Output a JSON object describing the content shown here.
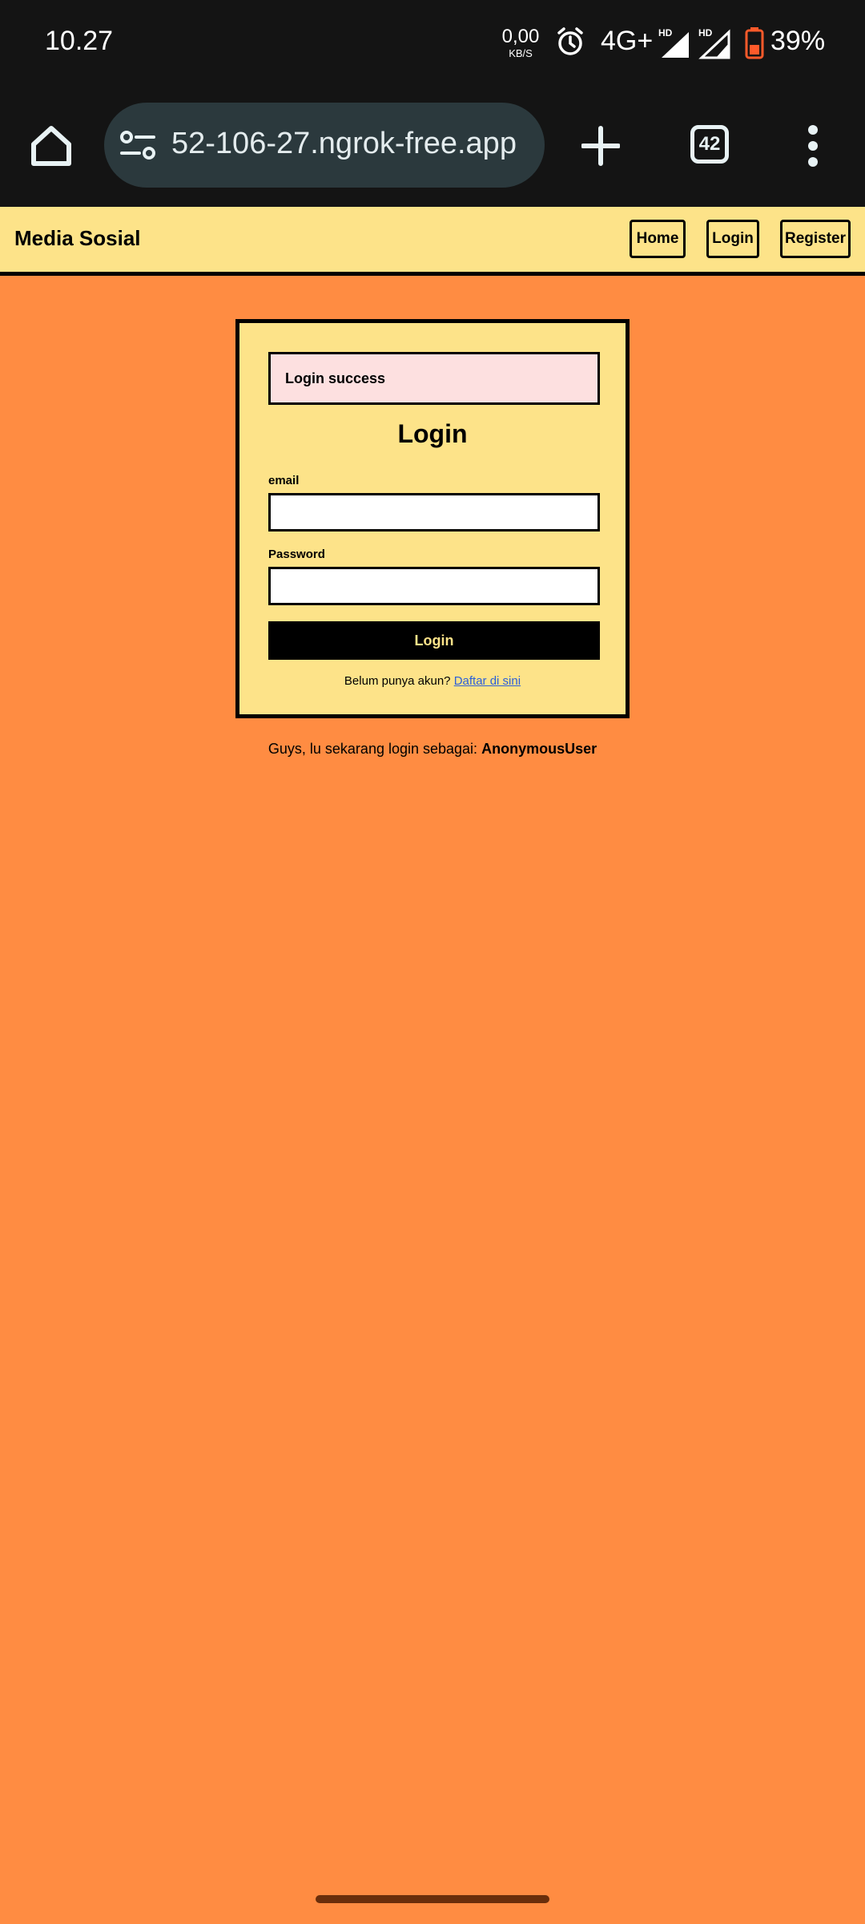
{
  "status_bar": {
    "time": "10.27",
    "net_speed_value": "0,00",
    "net_speed_unit": "KB/S",
    "network_type": "4G+",
    "battery_percent": "39%",
    "battery_color": "#ff5a2a"
  },
  "browser": {
    "url": "52-106-27.ngrok-free.app",
    "tab_count": "42",
    "icons": [
      "home-icon",
      "site-settings-icon",
      "new-tab-icon",
      "tab-switcher-icon",
      "more-menu-icon"
    ]
  },
  "navbar": {
    "brand": "Media Sosial",
    "links": [
      "Home",
      "Login",
      "Register"
    ]
  },
  "login_card": {
    "alert": "Login success",
    "title": "Login",
    "email_label": "email",
    "email_value": "",
    "password_label": "Password",
    "password_value": "",
    "submit_label": "Login",
    "signup_prompt": "Belum punya akun?",
    "signup_link": "Daftar di sini"
  },
  "footer": {
    "prefix": "Guys, lu sekarang login sebagai:",
    "username": "AnonymousUser"
  },
  "colors": {
    "page_background": "#ff8c42",
    "card_background": "#fde389",
    "alert_background": "#fde0e0",
    "link": "#2b5fd9"
  }
}
